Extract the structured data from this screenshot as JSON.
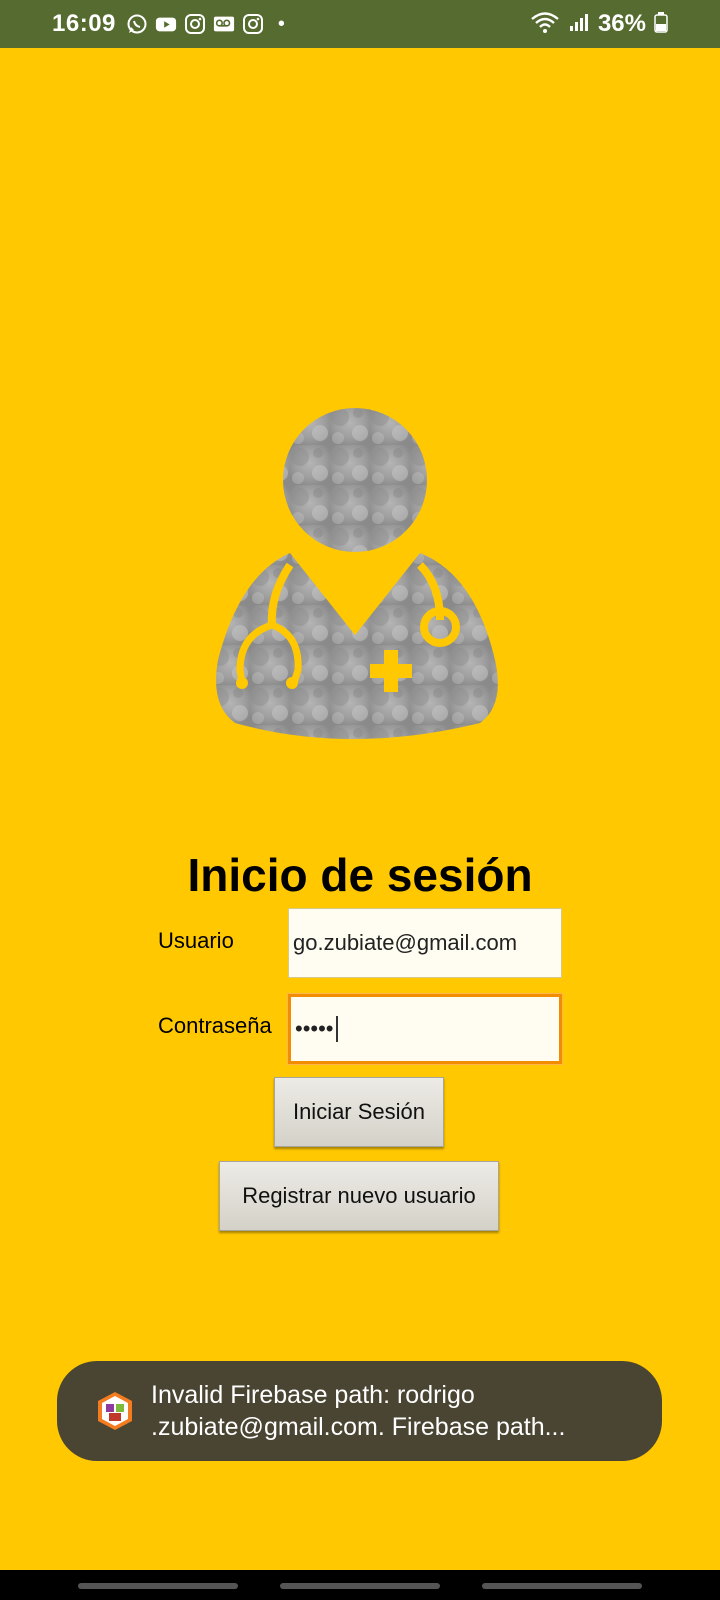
{
  "status_bar": {
    "time": "16:09",
    "notification_icons": [
      "whatsapp-icon",
      "youtube-icon",
      "instagram-icon",
      "voicemail-icon",
      "instagram-icon"
    ],
    "dot": "•",
    "battery": "36%"
  },
  "login": {
    "title": "Inicio de sesión",
    "user_label": "Usuario",
    "user_value": "go.zubiate@gmail.com",
    "password_label": "Contraseña",
    "password_value": "•••••",
    "login_button": "Iniciar Sesión",
    "register_button": "Registrar nuevo usuario"
  },
  "toast": {
    "line1": "Invalid Firebase path: rodrigo",
    "line2": ".zubiate@gmail.com. Firebase path..."
  },
  "colors": {
    "background": "#FFC800",
    "status_bar": "#556B2F",
    "toast": "#4A4532",
    "focus_border": "#F28C00"
  }
}
